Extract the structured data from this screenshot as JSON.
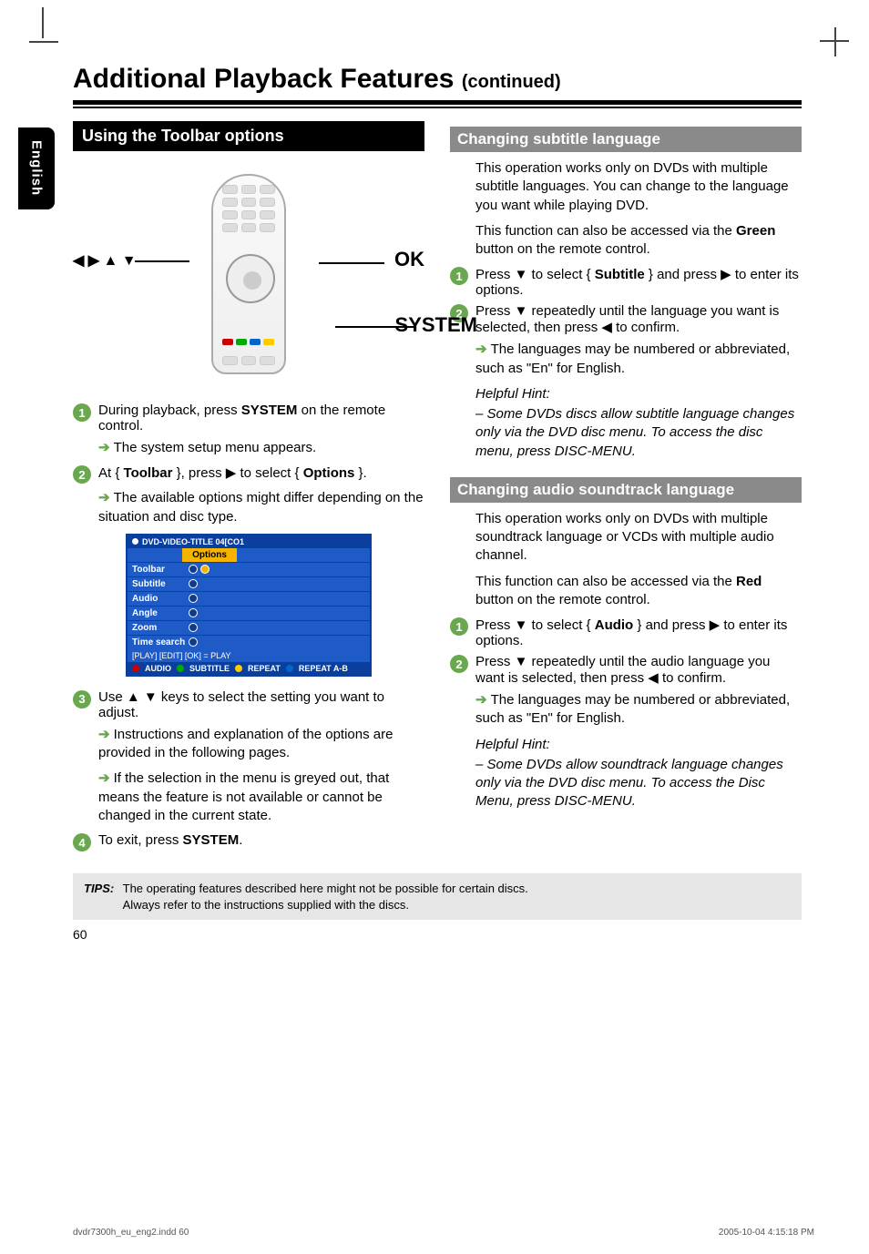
{
  "page": {
    "sideTab": "English",
    "title": "Additional Playback Features",
    "titleCont": "(continued)",
    "pageNum": "60"
  },
  "left": {
    "sectionHead": "Using the Toolbar options",
    "remote": {
      "arrows": "◀ ▶ ▲ ▼",
      "okLabel": "OK",
      "systemLabel": "SYSTEM"
    },
    "step1": {
      "num": "1",
      "text1": "During playback, press ",
      "bold1": "SYSTEM",
      "text2": " on the remote control.",
      "result": "The system setup menu appears."
    },
    "step2": {
      "num": "2",
      "text1": "At { ",
      "bold1": "Toolbar",
      "text2": " }, press ▶ to select { ",
      "bold2": "Options",
      "text3": " }.",
      "result": "The available options might differ depending on the situation and disc type."
    },
    "osd": {
      "title": "DVD-VIDEO-TITLE 04[CO1",
      "tab": "Options",
      "rows": [
        "Toolbar",
        "Subtitle",
        "Audio",
        "Angle",
        "Zoom",
        "Time search"
      ],
      "footPlay": "[PLAY] [EDIT] [OK] = PLAY",
      "footer": {
        "audio": "AUDIO",
        "subtitle": "SUBTITLE",
        "repeat": "REPEAT",
        "repeatAB": "REPEAT A-B"
      }
    },
    "step3": {
      "num": "3",
      "text1": "Use ▲ ▼ keys to select the setting you want to adjust.",
      "result1": "Instructions and explanation of the options are provided in the following pages.",
      "result2": "If the selection in the menu is greyed out, that means the feature is not available or cannot be changed in the current state."
    },
    "step4": {
      "num": "4",
      "text1": "To exit, press ",
      "bold1": "SYSTEM",
      "text2": "."
    }
  },
  "right": {
    "subtitle": {
      "head": "Changing subtitle language",
      "p1": "This operation works only on DVDs with multiple subtitle languages.  You can change to the language you want while playing DVD.",
      "p2a": "This function can also be accessed via the ",
      "p2bold": "Green",
      "p2b": " button on the remote control.",
      "step1": {
        "num": "1",
        "a": "Press ▼ to select { ",
        "bold": "Subtitle",
        "b": " } and press ▶ to enter its options."
      },
      "step2": {
        "num": "2",
        "a": "Press ▼ repeatedly until the language you want is selected, then press ◀ to confirm.",
        "result": "The languages may be numbered or abbreviated, such as \"En\" for English."
      },
      "hintHead": "Helpful Hint:",
      "hintBody": "–  Some DVDs discs allow subtitle language changes only via the DVD disc menu. To access the disc menu, press DISC-MENU."
    },
    "audio": {
      "head": "Changing audio soundtrack language",
      "p1": "This operation works only on DVDs with multiple soundtrack language or VCDs with multiple audio channel.",
      "p2a": "This function can also be accessed via the ",
      "p2bold": "Red",
      "p2b": " button on the remote control.",
      "step1": {
        "num": "1",
        "a": "Press ▼ to select { ",
        "bold": "Audio",
        "b": " } and press ▶ to enter its options."
      },
      "step2": {
        "num": "2",
        "a": "Press ▼ repeatedly until the audio language you want is selected, then press ◀ to confirm.",
        "result": "The languages may be numbered or abbreviated, such as \"En\" for English."
      },
      "hintHead": "Helpful Hint:",
      "hintBody": "–  Some DVDs allow soundtrack language changes only via the DVD disc menu.  To access the Disc Menu, press DISC-MENU."
    }
  },
  "tips": {
    "label": "TIPS:",
    "line1": "The operating features described here might not be possible for certain discs.",
    "line2": "Always refer to the instructions supplied with the discs."
  },
  "footer": {
    "file": "dvdr7300h_eu_eng2.indd   60",
    "date": "2005-10-04   4:15:18 PM"
  }
}
